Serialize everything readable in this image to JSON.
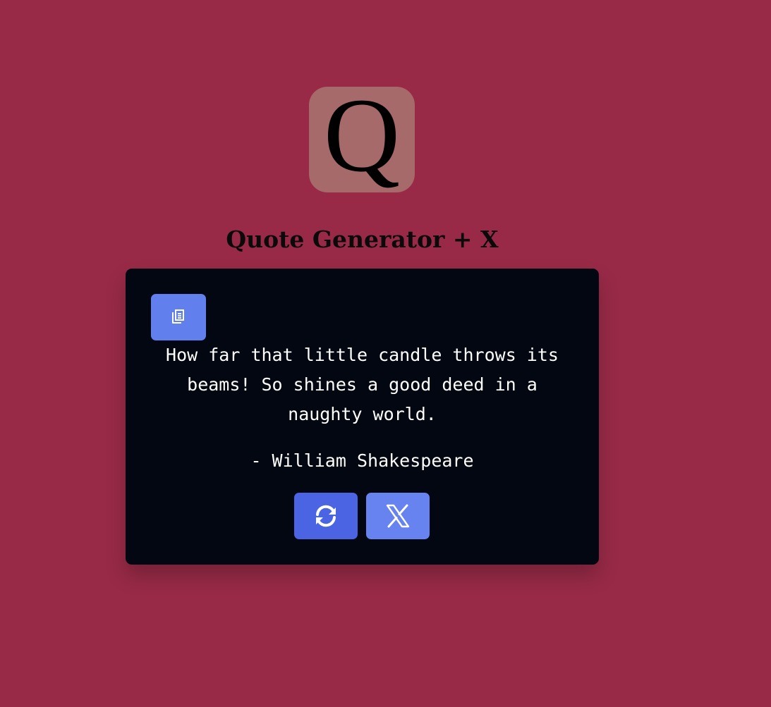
{
  "logo": {
    "letter": "Q"
  },
  "header": {
    "title": "Quote Generator + X"
  },
  "quote": {
    "text": "How far that little candle throws its beams! So shines a good deed in a naughty world.",
    "author": "- William Shakespeare"
  },
  "buttons": {
    "copy": {
      "icon": "copy-icon"
    },
    "new_quote": {
      "icon": "refresh-icon"
    },
    "tweet": {
      "icon": "x-logo-icon"
    }
  },
  "colors": {
    "background": "#982a47",
    "logo_tile": "#a66a6a",
    "card": "#030712",
    "copy_button": "#6180ee",
    "new_quote_button": "#4a64e3",
    "tweet_button": "#6683ef",
    "text": "#ffffff"
  }
}
